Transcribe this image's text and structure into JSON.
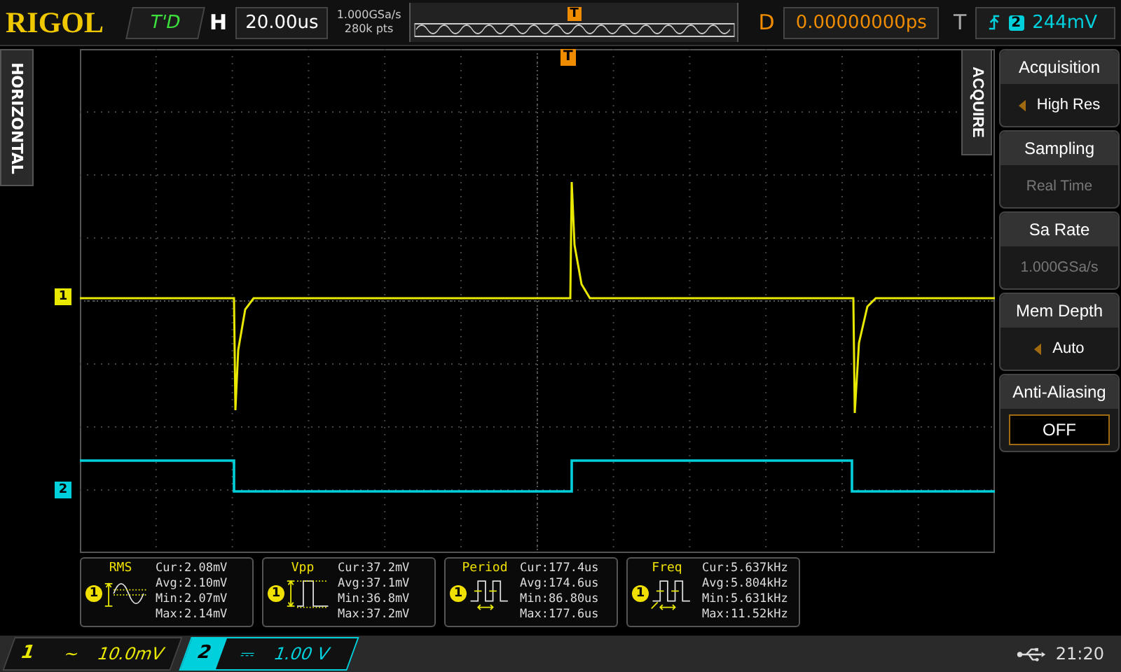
{
  "brand": "RIGOL",
  "run_state": "T'D",
  "timebase": {
    "label": "H",
    "value": "20.00us",
    "sample_rate": "1.000GSa/s",
    "points": "280k pts",
    "overview_marker": "T"
  },
  "delay": {
    "label": "D",
    "value": "0.00000000ps"
  },
  "trigger": {
    "label": "T",
    "source": "2",
    "level": "244mV",
    "grid_marker": "T"
  },
  "side_tab": "HORIZONTAL",
  "menu": {
    "title": "ACQUIRE",
    "items": [
      {
        "kind": "select",
        "title": "Acquisition",
        "value": "High Res"
      },
      {
        "kind": "readonly",
        "title": "Sampling",
        "value": "Real Time"
      },
      {
        "kind": "readonly",
        "title": "Sa Rate",
        "value": "1.000GSa/s"
      },
      {
        "kind": "select",
        "title": "Mem Depth",
        "value": "Auto"
      },
      {
        "kind": "toggle",
        "title": "Anti-Aliasing",
        "value": "OFF"
      }
    ]
  },
  "channel_markers": [
    {
      "label": "1",
      "color": "#e8e800"
    },
    {
      "label": "2",
      "color": "#00d0dc"
    }
  ],
  "measurements": [
    {
      "kind": "rms",
      "name": "RMS",
      "source": "1",
      "lines": [
        "Cur:2.08mV",
        "Avg:2.10mV",
        "Min:2.07mV",
        "Max:2.14mV"
      ]
    },
    {
      "kind": "vpp",
      "name": "Vpp",
      "source": "1",
      "lines": [
        "Cur:37.2mV",
        "Avg:37.1mV",
        "Min:36.8mV",
        "Max:37.2mV"
      ]
    },
    {
      "kind": "period",
      "name": "Period",
      "source": "1",
      "lines": [
        "Cur:177.4us",
        "Avg:174.6us",
        "Min:86.80us",
        "Max:177.6us"
      ]
    },
    {
      "kind": "freq",
      "name": "Freq",
      "source": "1",
      "lines": [
        "Cur:5.637kHz",
        "Avg:5.804kHz",
        "Min:5.631kHz",
        "Max:11.52kHz"
      ]
    }
  ],
  "channels": [
    {
      "number": "1",
      "coupling": "~",
      "scale": "10.0mV",
      "selected": false,
      "color": "#e8e800"
    },
    {
      "number": "2",
      "coupling": "⎓",
      "scale": "1.00 V",
      "selected": true,
      "color": "#00d0dc"
    }
  ],
  "status": {
    "time": "21:20"
  }
}
